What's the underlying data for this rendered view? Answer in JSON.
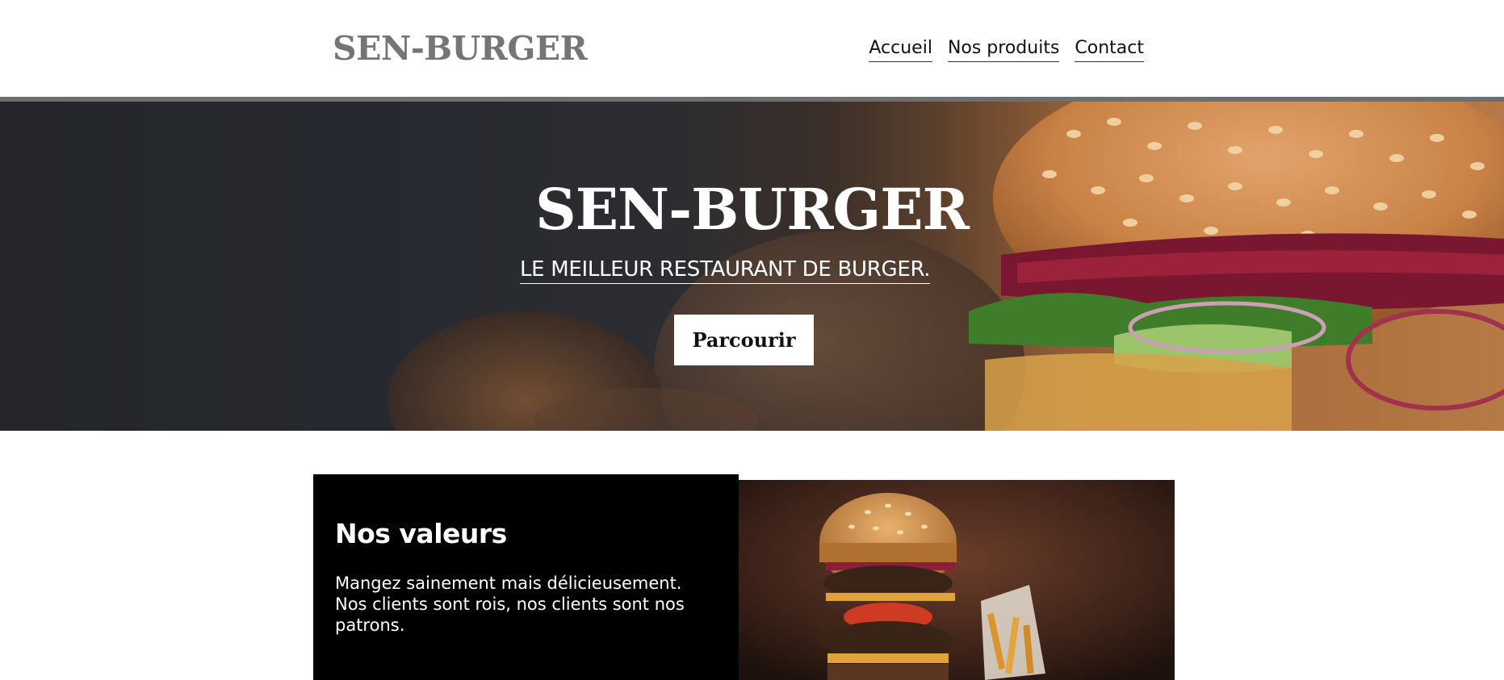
{
  "header": {
    "logo": "SEN-BURGER",
    "nav": [
      {
        "label": "Accueil"
      },
      {
        "label": "Nos produits"
      },
      {
        "label": "Contact"
      }
    ]
  },
  "hero": {
    "title": "SEN-BURGER",
    "subtitle": "LE MEILLEUR RESTAURANT DE BURGER.",
    "button_label": "Parcourir",
    "image": "burger-hero-photo"
  },
  "values": {
    "title": "Nos valeurs",
    "text": "Mangez sainement mais délicieusement. Nos clients sont rois, nos clients sont nos patrons.",
    "image": "burger-fries-photo"
  },
  "colors": {
    "logo": "#757575",
    "header_bar": "#6e6e6e",
    "hero_dark": "#26282d",
    "card_bg": "#000000"
  }
}
